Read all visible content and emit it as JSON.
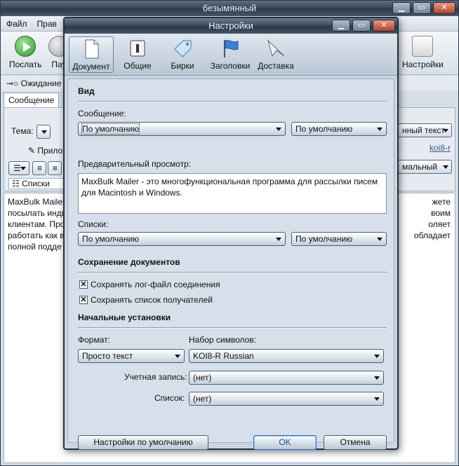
{
  "main": {
    "title": "безымянный",
    "menu": [
      "Файл",
      "Прав"
    ],
    "toolbar": {
      "send": "Послать",
      "pause": "Пау",
      "settings": "Настройки"
    },
    "status": "Ожидание",
    "tabs": [
      "Сообщение"
    ],
    "subject_label": "Тема:",
    "attach_label": "Прило",
    "lists_label": "Списки",
    "right_combo_1": "нный текст",
    "right_combo_2": "мальный",
    "charset_link": "koi8-r",
    "body_left": [
      "MaxBulk Mailer",
      "посылать инди",
      "клиентам. Прос",
      "работать как в",
      "полной подде"
    ],
    "body_right": [
      "жете",
      "воим",
      "оляет",
      "обладает"
    ]
  },
  "dialog": {
    "title": "Настройки",
    "tabs": [
      {
        "label": "Документ",
        "icon": "document-icon"
      },
      {
        "label": "Общие",
        "icon": "switch-icon"
      },
      {
        "label": "Бирки",
        "icon": "tag-icon"
      },
      {
        "label": "Заголовки",
        "icon": "flag-icon"
      },
      {
        "label": "Доставка",
        "icon": "paper-plane-icon"
      }
    ],
    "view": {
      "heading": "Вид",
      "message_label": "Сообщение:",
      "message_combo_1": "По умолчанию",
      "message_combo_2": "По умолчанию",
      "preview_label": "Предварительный просмотр:",
      "preview_text": "MaxBulk Mailer - это многофункциональная программа для рассылки писем для Macintosh и Windows.",
      "lists_label": "Списки:",
      "lists_combo_1": "По умолчанию",
      "lists_combo_2": "По умолчанию"
    },
    "save": {
      "heading": "Сохранение документов",
      "check_log": "Сохранять лог-файл соединения",
      "check_recipients": "Сохранять список получателей"
    },
    "init": {
      "heading": "Начальные установки",
      "format_label": "Формат:",
      "format_value": "Просто текст",
      "charset_label": "Набор символов:",
      "charset_value": "KOI8-R Russian",
      "account_label": "Учетная запись:",
      "account_value": "(нет)",
      "list_label": "Список:",
      "list_value": "(нет)"
    },
    "buttons": {
      "defaults": "Настройки по умолчанию",
      "ok": "OK",
      "cancel": "Отмена"
    }
  }
}
